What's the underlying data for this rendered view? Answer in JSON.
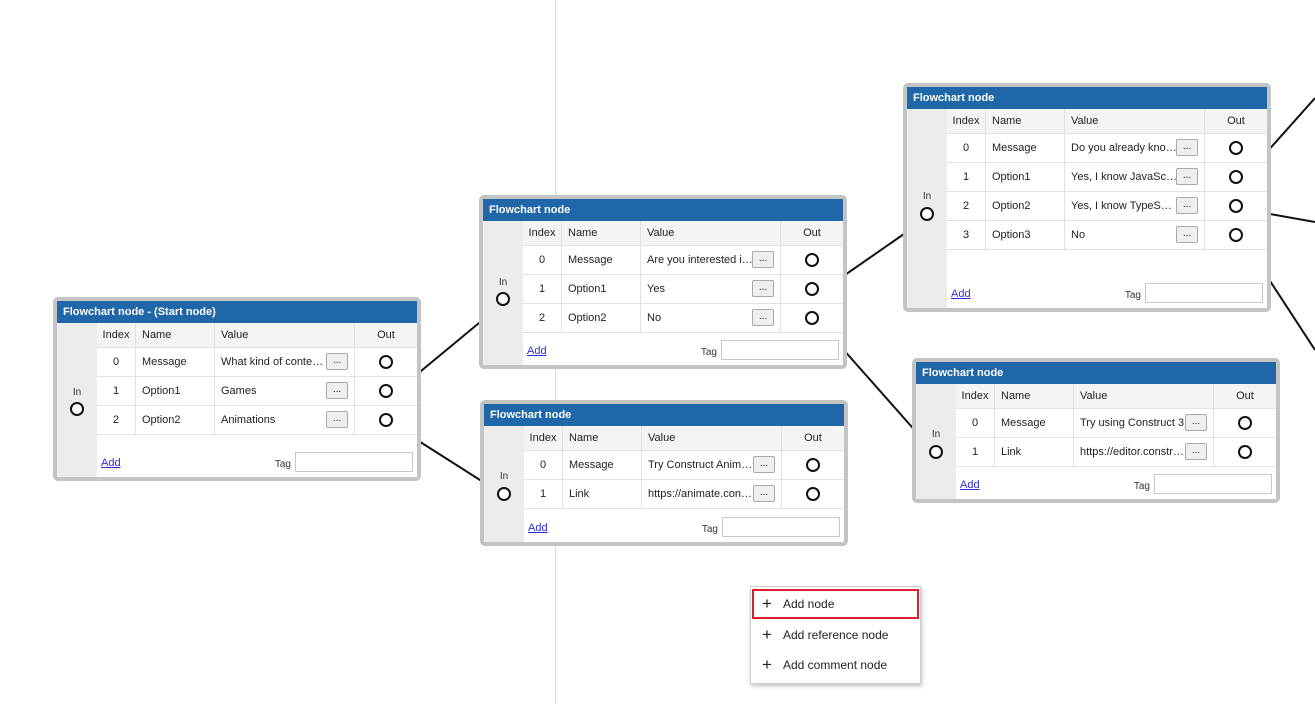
{
  "headers": {
    "index": "Index",
    "name": "Name",
    "value": "Value",
    "out": "Out"
  },
  "labels": {
    "in": "In",
    "add": "Add",
    "tag": "Tag",
    "more": "..."
  },
  "nodes": [
    {
      "title": "Flowchart node - (Start node)",
      "rows": [
        {
          "index": "0",
          "name": "Message",
          "value": "What kind of content are you looking for?"
        },
        {
          "index": "1",
          "name": "Option1",
          "value": "Games"
        },
        {
          "index": "2",
          "name": "Option2",
          "value": "Animations"
        }
      ]
    },
    {
      "title": "Flowchart node",
      "rows": [
        {
          "index": "0",
          "name": "Message",
          "value": "Are you interested in programming?"
        },
        {
          "index": "1",
          "name": "Option1",
          "value": "Yes"
        },
        {
          "index": "2",
          "name": "Option2",
          "value": "No"
        }
      ]
    },
    {
      "title": "Flowchart node",
      "rows": [
        {
          "index": "0",
          "name": "Message",
          "value": "Try Construct Animate"
        },
        {
          "index": "1",
          "name": "Link",
          "value": "https://animate.construct.net"
        }
      ]
    },
    {
      "title": "Flowchart node",
      "rows": [
        {
          "index": "0",
          "name": "Message",
          "value": "Do you already know a programming language?"
        },
        {
          "index": "1",
          "name": "Option1",
          "value": "Yes, I know JavaScript"
        },
        {
          "index": "2",
          "name": "Option2",
          "value": "Yes, I know TypeScript"
        },
        {
          "index": "3",
          "name": "Option3",
          "value": "No"
        }
      ]
    },
    {
      "title": "Flowchart node",
      "rows": [
        {
          "index": "0",
          "name": "Message",
          "value": "Try using Construct 3"
        },
        {
          "index": "1",
          "name": "Link",
          "value": "https://editor.construct.net"
        }
      ]
    }
  ],
  "context_menu": {
    "items": [
      {
        "label": "Add node",
        "icon": "plus-icon",
        "selected": true
      },
      {
        "label": "Add reference node",
        "icon": "plus-icon",
        "selected": false
      },
      {
        "label": "Add comment node",
        "icon": "plus-icon",
        "selected": false
      }
    ],
    "highlight_color": "#d9202f"
  },
  "colors": {
    "header_bg": "#1f67a8",
    "node_frame": "#c4c4c4",
    "link": "#2d2dd6"
  }
}
